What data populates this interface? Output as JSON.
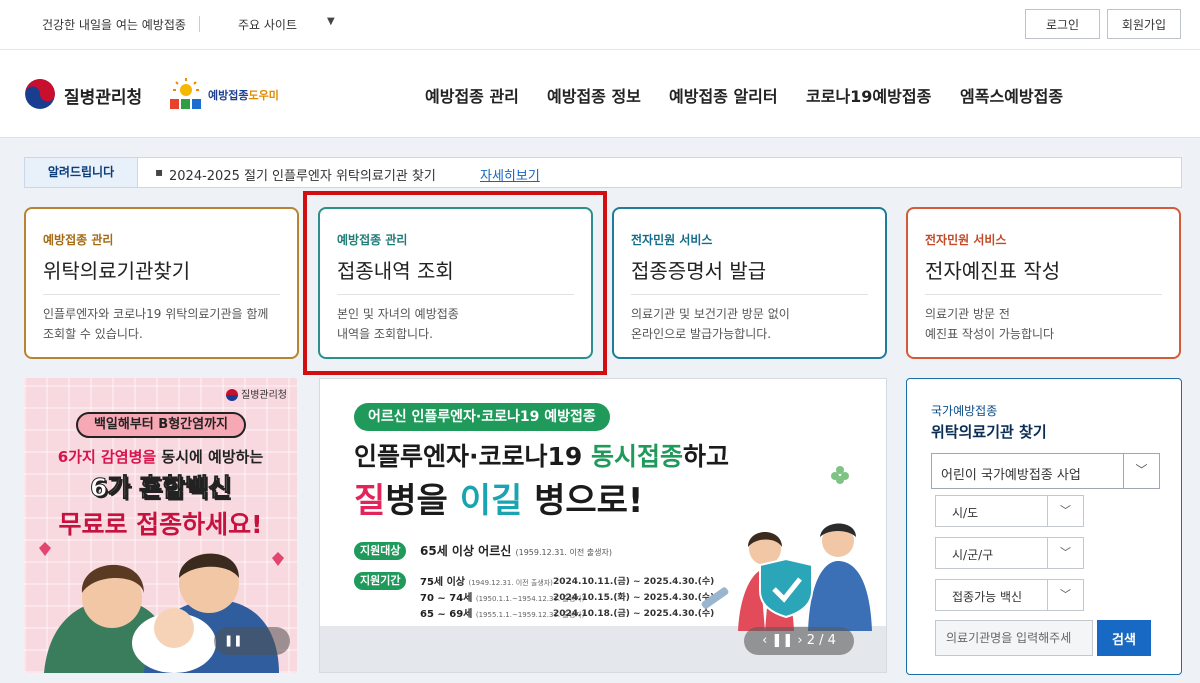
{
  "topbar": {
    "slogan": "건강한 내일을 여는 예방접종",
    "sites_label": "주요 사이트",
    "login": "로그인",
    "join": "회원가입"
  },
  "header": {
    "agency": "질병관리청",
    "nip_brand_a": "예방접종",
    "nip_brand_b": "도우미",
    "nav": [
      "예방접종 관리",
      "예방접종 정보",
      "예방접종 알리터",
      "코로나19예방접종",
      "엠폭스예방접종"
    ]
  },
  "notice": {
    "tag": "알려드립니다",
    "text": "2024-2025 절기 인플루엔자 위탁의료기관 찾기",
    "link": "자세히보기"
  },
  "cards": [
    {
      "category": "예방접종 관리",
      "title": "위탁의료기관찾기",
      "desc1": "인플루엔자와 코로나19 위탁의료기관을 함께",
      "desc2": "조회할 수 있습니다."
    },
    {
      "category": "예방접종 관리",
      "title": "접종내역 조회",
      "desc1": "본인 및 자녀의 예방접종",
      "desc2": "내역을 조회합니다."
    },
    {
      "category": "전자민원 서비스",
      "title": "접종증명서 발급",
      "desc1": "의료기관 및 보건기관 방문 없이",
      "desc2": "온라인으로 발급가능합니다."
    },
    {
      "category": "전자민원 서비스",
      "title": "전자예진표 작성",
      "desc1": "의료기관 방문 전",
      "desc2": "예진표 작성이 가능합니다"
    }
  ],
  "banner_left": {
    "logo": "질병관리청",
    "pill": "백일해부터 B형간염까지",
    "line1_a": "6가지 감염병을",
    "line1_b": " 동시에 예방하는",
    "line2": "6가 혼합백신",
    "line3": "무료로 접종하세요!"
  },
  "banner_mid": {
    "pill": "어르신 인플루엔자·코로나19 예방접종",
    "l1_a": "인플루엔자·코로나19 ",
    "l1_b": "동시접종",
    "l1_c": "하고",
    "l2_a": "질",
    "l2_b": "병을 ",
    "l2_c": "이길",
    "l2_d": " 병으로!",
    "tag1": "지원대상",
    "target": "65세 이상 어르신",
    "target_note": "(1959.12.31. 이전 출생자)",
    "tag2": "지원기간",
    "rows": [
      {
        "age": "75세 이상",
        "note": "(1949.12.31. 이전 출생자)",
        "period": "2024.10.11.(금) ~ 2025.4.30.(수)"
      },
      {
        "age": "70 ~ 74세",
        "note": "(1950.1.1.~1954.12.31. 출생자)",
        "period": "2024.10.15.(화) ~ 2025.4.30.(수)"
      },
      {
        "age": "65 ~ 69세",
        "note": "(1955.1.1.~1959.12.31. 출생자)",
        "period": "2024.10.18.(금) ~ 2025.4.30.(수)"
      }
    ],
    "slide_counter": "2 / 4"
  },
  "search": {
    "subtitle": "국가예방접종",
    "title": "위탁의료기관 찾기",
    "program_select": "어린이 국가예방접종 사업",
    "sido": "시/도",
    "sigungu": "시/군/구",
    "vaccine": "접종가능 백신",
    "input_placeholder": "의료기관명을 입력해주세",
    "button": "검색"
  },
  "colors": {
    "card1": "#b88432",
    "card2": "#2c8f8a",
    "card3": "#1e7c9a",
    "card4": "#d45a3a",
    "highlight": "#d10f10",
    "search_button": "#1769c4"
  }
}
